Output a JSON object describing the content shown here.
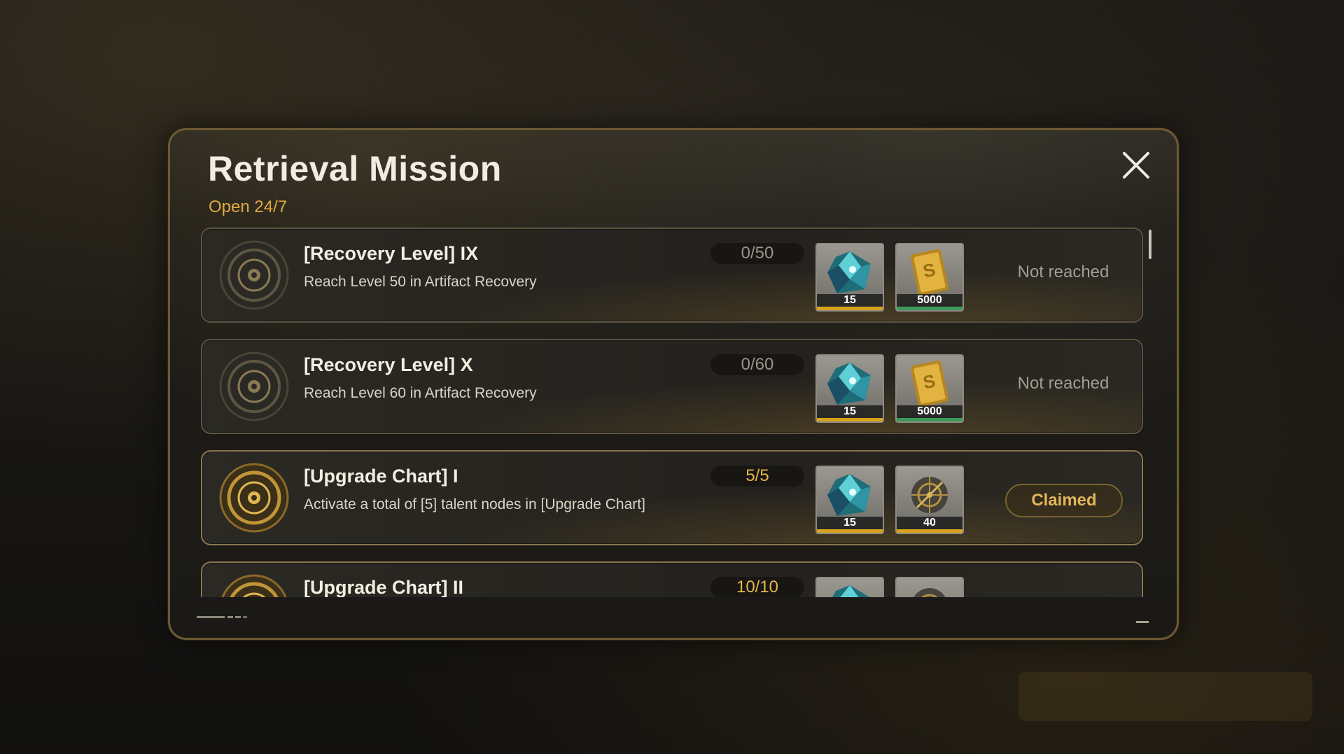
{
  "modal": {
    "title": "Retrieval Mission",
    "subtitle": "Open 24/7",
    "close_icon": "close-icon"
  },
  "missions": [
    {
      "name": "[Recovery Level] IX",
      "description": "Reach Level 50 in Artifact Recovery",
      "progress": "0/50",
      "status": "Not reached",
      "completed": false,
      "rewards": [
        {
          "icon": "crystal-icon",
          "qty": "15",
          "rarity_color": "#d8a21c"
        },
        {
          "icon": "gold-bar-icon",
          "qty": "5000",
          "rarity_color": "#3c9a5a"
        }
      ]
    },
    {
      "name": "[Recovery Level] X",
      "description": "Reach Level 60 in Artifact Recovery",
      "progress": "0/60",
      "status": "Not reached",
      "completed": false,
      "rewards": [
        {
          "icon": "crystal-icon",
          "qty": "15",
          "rarity_color": "#d8a21c"
        },
        {
          "icon": "gold-bar-icon",
          "qty": "5000",
          "rarity_color": "#3c9a5a"
        }
      ]
    },
    {
      "name": "[Upgrade Chart] I",
      "description": "Activate a total of [5] talent nodes in [Upgrade Chart]",
      "progress": "5/5",
      "status": "Claimed",
      "completed": true,
      "rewards": [
        {
          "icon": "crystal-icon",
          "qty": "15",
          "rarity_color": "#d8a21c"
        },
        {
          "icon": "compass-gear-icon",
          "qty": "40",
          "rarity_color": "#d8a21c"
        }
      ]
    },
    {
      "name": "[Upgrade Chart] II",
      "description": "",
      "progress": "10/10",
      "status": "",
      "completed": true,
      "rewards": [
        {
          "icon": "crystal-icon",
          "qty": "",
          "rarity_color": "#d8a21c"
        },
        {
          "icon": "compass-gear-icon",
          "qty": "",
          "rarity_color": "#d8a21c"
        }
      ]
    }
  ],
  "colors": {
    "accent_gold": "#e0a940",
    "title_white": "#f1ede4",
    "status_gray": "#a29d92"
  }
}
